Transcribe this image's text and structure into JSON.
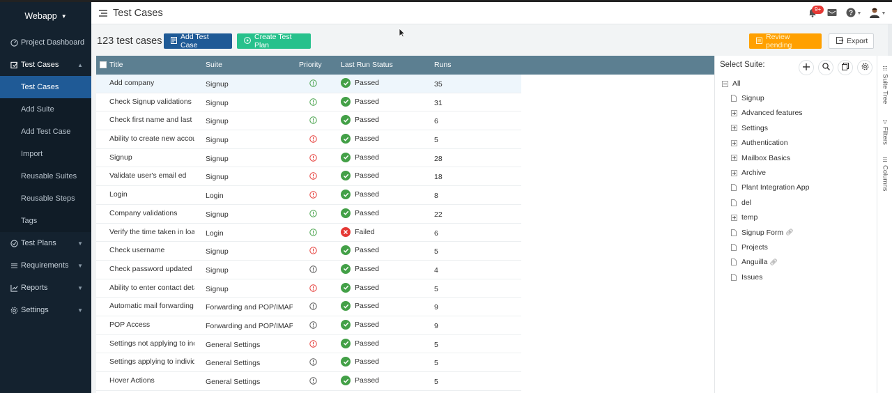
{
  "app": {
    "name": "Webapp"
  },
  "sidebar": {
    "items": [
      {
        "label": "Project Dashboard",
        "icon": "dashboard-icon"
      },
      {
        "label": "Test Cases",
        "icon": "test-cases-icon",
        "open": true
      },
      {
        "label": "Test Plans",
        "icon": "test-plans-icon"
      },
      {
        "label": "Requirements",
        "icon": "requirements-icon"
      },
      {
        "label": "Reports",
        "icon": "reports-icon"
      },
      {
        "label": "Settings",
        "icon": "settings-icon"
      }
    ],
    "sub_items": [
      "Test Cases",
      "Add Suite",
      "Add Test Case",
      "Import",
      "Reusable Suites",
      "Reusable Steps",
      "Tags"
    ],
    "active_sub": "Test Cases"
  },
  "header": {
    "title": "Test Cases",
    "notification_badge": "9+"
  },
  "toolbar": {
    "count_label": "123 test cases",
    "add_test_case": "Add Test Case",
    "create_test_plan": "Create Test Plan",
    "review_pending": "Review pending",
    "export": "Export"
  },
  "table": {
    "columns": [
      "Title",
      "Suite",
      "Priority",
      "Last Run Status",
      "Runs"
    ],
    "rows": [
      {
        "title": "Add company",
        "suite": "Signup",
        "priority": "low",
        "status": "Passed",
        "runs": "35"
      },
      {
        "title": "Check Signup validations",
        "suite": "Signup",
        "priority": "low",
        "status": "Passed",
        "runs": "31"
      },
      {
        "title": "Check first name and last na",
        "suite": "Signup",
        "priority": "low",
        "status": "Passed",
        "runs": "6"
      },
      {
        "title": "Ability to create new accoun",
        "suite": "Signup",
        "priority": "high",
        "status": "Passed",
        "runs": "5"
      },
      {
        "title": "Signup",
        "suite": "Signup",
        "priority": "high",
        "status": "Passed",
        "runs": "28"
      },
      {
        "title": "Validate user's email ed",
        "suite": "Signup",
        "priority": "high",
        "status": "Passed",
        "runs": "18"
      },
      {
        "title": "Login",
        "suite": "Login",
        "priority": "high",
        "status": "Passed",
        "runs": "8"
      },
      {
        "title": "Company validations",
        "suite": "Signup",
        "priority": "low",
        "status": "Passed",
        "runs": "22"
      },
      {
        "title": "Verify the time taken in load",
        "suite": "Login",
        "priority": "low",
        "status": "Failed",
        "runs": "6"
      },
      {
        "title": "Check username",
        "suite": "Signup",
        "priority": "high",
        "status": "Passed",
        "runs": "5"
      },
      {
        "title": "Check password updated",
        "suite": "Signup",
        "priority": "normal",
        "status": "Passed",
        "runs": "4"
      },
      {
        "title": "Ability to enter contact detai",
        "suite": "Signup",
        "priority": "high",
        "status": "Passed",
        "runs": "5"
      },
      {
        "title": "Automatic mail forwarding",
        "suite": "Forwarding and POP/IMAP",
        "priority": "normal",
        "status": "Passed",
        "runs": "9"
      },
      {
        "title": "POP Access",
        "suite": "Forwarding and POP/IMAP",
        "priority": "normal",
        "status": "Passed",
        "runs": "9"
      },
      {
        "title": "Settings not applying to indi",
        "suite": "General Settings",
        "priority": "high",
        "status": "Passed",
        "runs": "5"
      },
      {
        "title": "Settings applying to individu",
        "suite": "General Settings",
        "priority": "normal",
        "status": "Passed",
        "runs": "5"
      },
      {
        "title": "Hover Actions",
        "suite": "General Settings",
        "priority": "normal",
        "status": "Passed",
        "runs": "5"
      }
    ]
  },
  "suite_panel": {
    "title": "Select Suite:",
    "root": "All",
    "items": [
      {
        "label": "Signup",
        "type": "file"
      },
      {
        "label": "Advanced features",
        "type": "folder"
      },
      {
        "label": "Settings",
        "type": "folder"
      },
      {
        "label": "Authentication",
        "type": "folder"
      },
      {
        "label": "Mailbox Basics",
        "type": "folder"
      },
      {
        "label": "Archive",
        "type": "folder"
      },
      {
        "label": "Plant Integration App",
        "type": "file"
      },
      {
        "label": "del",
        "type": "file"
      },
      {
        "label": "temp",
        "type": "folder"
      },
      {
        "label": "Signup Form",
        "type": "file",
        "linked": true
      },
      {
        "label": "Projects",
        "type": "file"
      },
      {
        "label": "Anguilla",
        "type": "file",
        "linked": true
      },
      {
        "label": "Issues",
        "type": "file"
      }
    ]
  },
  "side_tabs": [
    "Suite Tree",
    "Filters",
    "Columns"
  ],
  "colors": {
    "sidebar_bg": "#14222f",
    "primary": "#1f5a96",
    "success": "#27c18c",
    "warning": "#ffa000",
    "table_header": "#5c7f91",
    "passed": "#43a047",
    "failed": "#e53935"
  }
}
